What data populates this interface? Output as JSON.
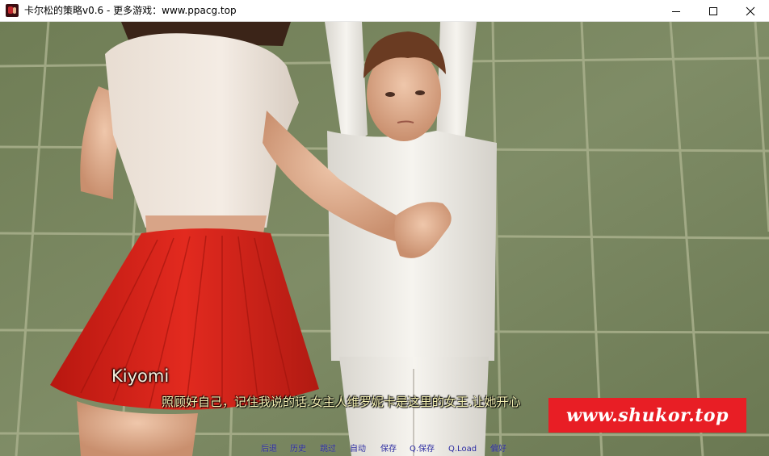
{
  "window": {
    "title": "卡尔松的策略v0.6 - 更多游戏：www.ppacg.top",
    "controls": {
      "minimize_icon": "minimize-icon",
      "maximize_icon": "maximize-icon",
      "close_icon": "close-icon"
    }
  },
  "dialogue": {
    "speaker": "Kiyomi",
    "text": "照顾好自己，记住我说的话.女主人维罗妮卡是这里的女王.让她开心"
  },
  "watermark": {
    "text": "www.shukor.top",
    "color": "#e81e25"
  },
  "quick_menu": {
    "items": [
      {
        "label": "后退"
      },
      {
        "label": "历史"
      },
      {
        "label": "跳过"
      },
      {
        "label": "自动"
      },
      {
        "label": "保存"
      },
      {
        "label": "Q.保存"
      },
      {
        "label": "Q.Load"
      },
      {
        "label": "偏好"
      }
    ],
    "color": "#2a2aa0"
  },
  "colors": {
    "tile_grout": "#a9b08c",
    "tile": "#7d8a63",
    "skirt": "#d8231b",
    "dialogue_text": "#f6f2b4"
  }
}
